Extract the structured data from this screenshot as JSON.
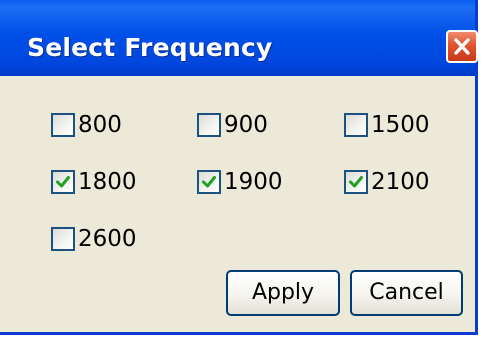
{
  "dialog": {
    "title": "Select Frequency",
    "close_icon": "close-icon"
  },
  "frequencies": [
    {
      "label": "800",
      "checked": false
    },
    {
      "label": "900",
      "checked": false
    },
    {
      "label": "1500",
      "checked": false
    },
    {
      "label": "1800",
      "checked": true
    },
    {
      "label": "1900",
      "checked": true
    },
    {
      "label": "2100",
      "checked": true
    },
    {
      "label": "2600",
      "checked": false
    }
  ],
  "buttons": {
    "apply_label": "Apply",
    "cancel_label": "Cancel"
  },
  "colors": {
    "titlebar": "#0050E8",
    "window_bg": "#ECE9D8",
    "checkmark": "#21A121",
    "close_button": "#E1552F"
  }
}
